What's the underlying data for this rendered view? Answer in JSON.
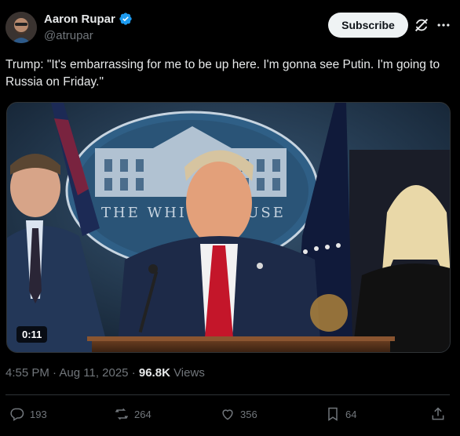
{
  "author": {
    "display_name": "Aaron Rupar",
    "handle": "@atrupar",
    "verified_icon": "verified-badge-icon",
    "avatar": "avatar"
  },
  "header": {
    "subscribe_label": "Subscribe",
    "grok_icon": "grok-icon",
    "more_icon": "more-icon"
  },
  "tweet": {
    "text": "Trump: \"It's embarrassing for me to be up here. I'm gonna see Putin. I'm going to Russia on Friday.\""
  },
  "media": {
    "duration": "0:11",
    "seal_text": "THE WHITE HOUSE"
  },
  "meta": {
    "time": "4:55 PM",
    "separator": "·",
    "date": "Aug 11, 2025",
    "views_count": "96.8K",
    "views_label": "Views"
  },
  "actions": {
    "replies": "193",
    "reposts": "264",
    "likes": "356",
    "bookmarks": "64"
  },
  "colors": {
    "background": "#000000",
    "text": "#e7e9ea",
    "muted": "#71767b",
    "verified": "#1d9bf0",
    "divider": "#2f3336"
  }
}
